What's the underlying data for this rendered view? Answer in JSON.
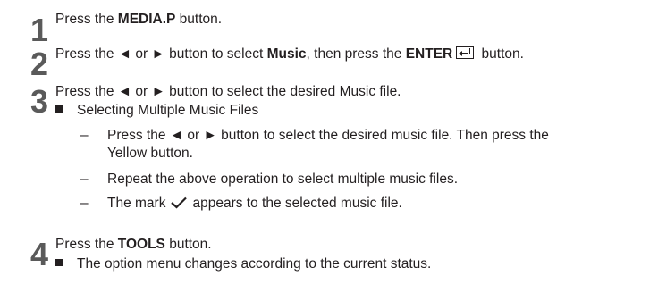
{
  "steps": [
    {
      "number": "1",
      "text_a": "Press the ",
      "bold_a": "MEDIA.P",
      "text_b": " button."
    },
    {
      "number": "2",
      "text_a": "Press the ◄ or ► button to select ",
      "bold_a": "Music",
      "text_b": ", then press the ",
      "bold_b": "ENTER",
      "text_c": " button."
    },
    {
      "number": "3",
      "text_a": "Press the ◄ or ► button to select the desired Music file.",
      "bullet": "Selecting Multiple Music Files",
      "dash_1_line_1": "Press the ◄ or ► button to select the desired music file. Then press the",
      "dash_1_line_2": "Yellow button.",
      "dash_2": "Repeat the above operation to select multiple music files.",
      "dash_3_a": "The mark",
      "dash_3_b": "appears to the selected music file."
    },
    {
      "number": "4",
      "text_a": "Press the ",
      "bold_a": "TOOLS",
      "text_b": " button.",
      "bullet": "The option menu changes according to the current status."
    }
  ],
  "icons": {
    "enter": "enter-icon",
    "check": "checkmark-icon"
  }
}
